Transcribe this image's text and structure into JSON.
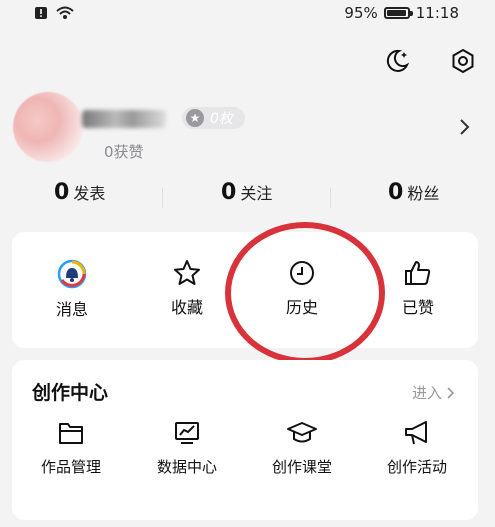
{
  "status_bar": {
    "battery": "95%",
    "battery_level": 0.95,
    "time": "11:18"
  },
  "header_icons": {
    "night_mode": "moon-sparkle-icon",
    "settings": "hexagon-gear-icon"
  },
  "profile": {
    "badge_text": "0枚",
    "likes_text": "0获赞"
  },
  "stats": [
    {
      "value": "0",
      "label": "发表"
    },
    {
      "value": "0",
      "label": "关注"
    },
    {
      "value": "0",
      "label": "粉丝"
    }
  ],
  "quick_actions": [
    {
      "label": "消息",
      "icon": "bell-icon"
    },
    {
      "label": "收藏",
      "icon": "star-icon"
    },
    {
      "label": "历史",
      "icon": "clock-icon"
    },
    {
      "label": "已赞",
      "icon": "thumbs-up-icon"
    }
  ],
  "creation_center": {
    "title": "创作中心",
    "enter_label": "进入",
    "tools": [
      {
        "label": "作品管理",
        "icon": "folder-icon"
      },
      {
        "label": "数据中心",
        "icon": "chart-monitor-icon"
      },
      {
        "label": "创作课堂",
        "icon": "graduation-cap-icon"
      },
      {
        "label": "创作活动",
        "icon": "megaphone-icon"
      }
    ]
  },
  "colors": {
    "highlight": "#d8323b",
    "card_bg": "#ffffff",
    "page_bg": "#f3f3f4"
  }
}
